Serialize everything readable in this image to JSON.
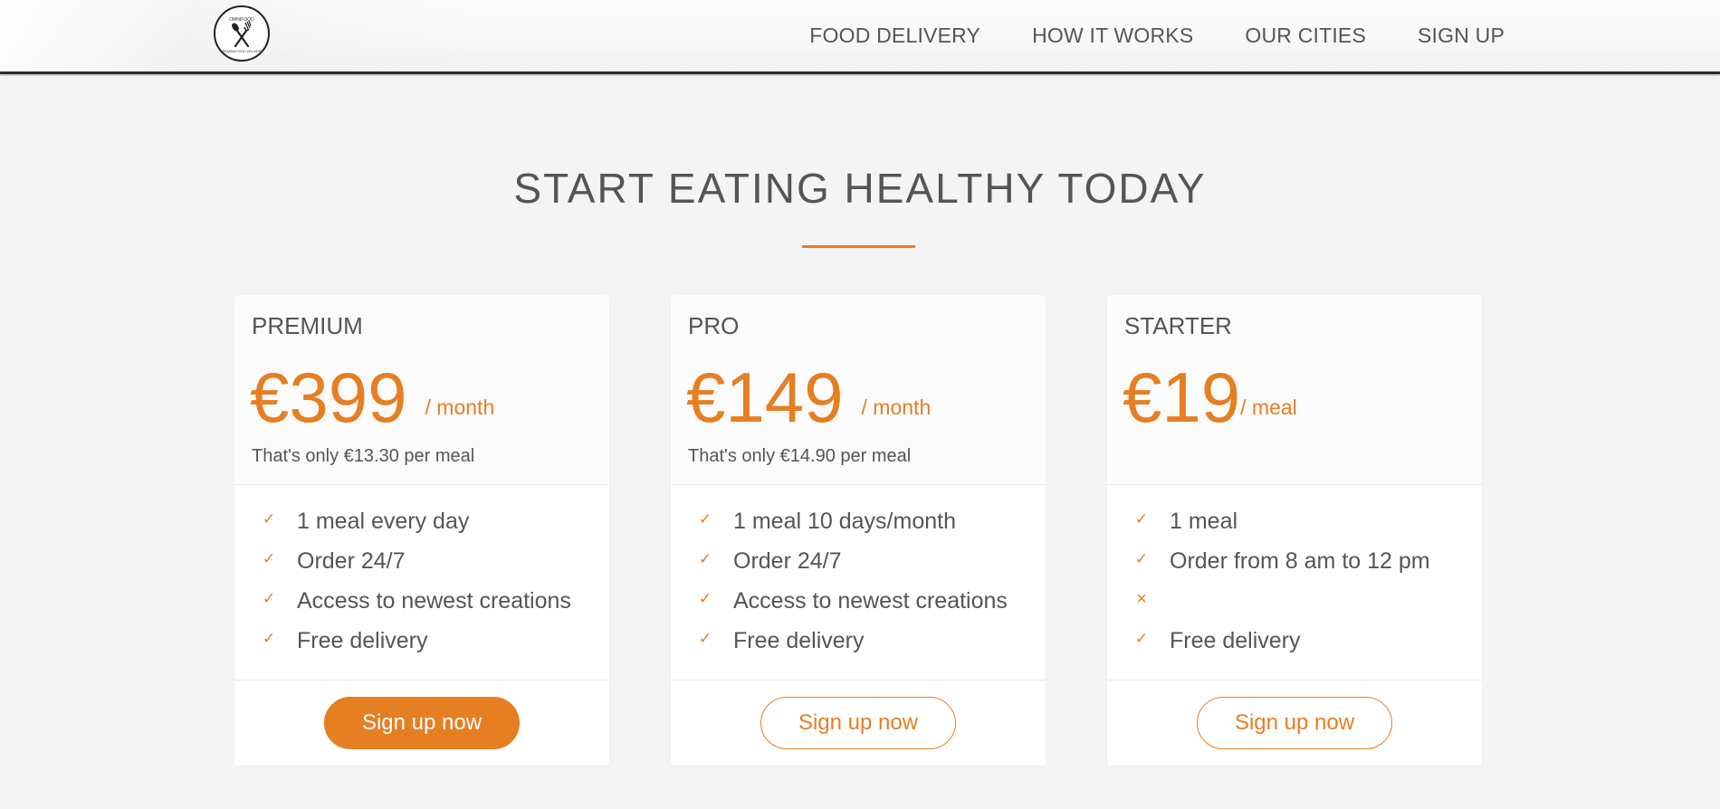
{
  "header": {
    "logo_text": "OMNIFOOD",
    "nav": [
      {
        "label": "FOOD DELIVERY"
      },
      {
        "label": "HOW IT WORKS"
      },
      {
        "label": "OUR CITIES"
      },
      {
        "label": "SIGN UP"
      }
    ]
  },
  "section": {
    "title": "START EATING HEALTHY TODAY",
    "accent_color": "#e67e22"
  },
  "plans": [
    {
      "name": "PREMIUM",
      "price": "€399",
      "unit": "/ month",
      "per_meal": "That's only €13.30 per meal",
      "features": [
        {
          "icon": "checkmark-icon",
          "text": "1 meal every day"
        },
        {
          "icon": "checkmark-icon",
          "text": "Order 24/7"
        },
        {
          "icon": "checkmark-icon",
          "text": "Access to newest creations"
        },
        {
          "icon": "checkmark-icon",
          "text": "Free delivery"
        }
      ],
      "button": "Sign up now",
      "button_style": "full"
    },
    {
      "name": "PRO",
      "price": "€149",
      "unit": "/ month",
      "per_meal": "That's only €14.90 per meal",
      "features": [
        {
          "icon": "checkmark-icon",
          "text": "1 meal 10 days/month"
        },
        {
          "icon": "checkmark-icon",
          "text": "Order 24/7"
        },
        {
          "icon": "checkmark-icon",
          "text": "Access to newest creations"
        },
        {
          "icon": "checkmark-icon",
          "text": "Free delivery"
        }
      ],
      "button": "Sign up now",
      "button_style": "ghost"
    },
    {
      "name": "STARTER",
      "price": "€19",
      "unit": "/ meal",
      "per_meal": "",
      "features": [
        {
          "icon": "checkmark-icon",
          "text": "1 meal"
        },
        {
          "icon": "checkmark-icon",
          "text": "Order from 8 am to 12 pm"
        },
        {
          "icon": "close-icon",
          "text": ""
        },
        {
          "icon": "checkmark-icon",
          "text": "Free delivery"
        }
      ],
      "button": "Sign up now",
      "button_style": "ghost"
    }
  ]
}
